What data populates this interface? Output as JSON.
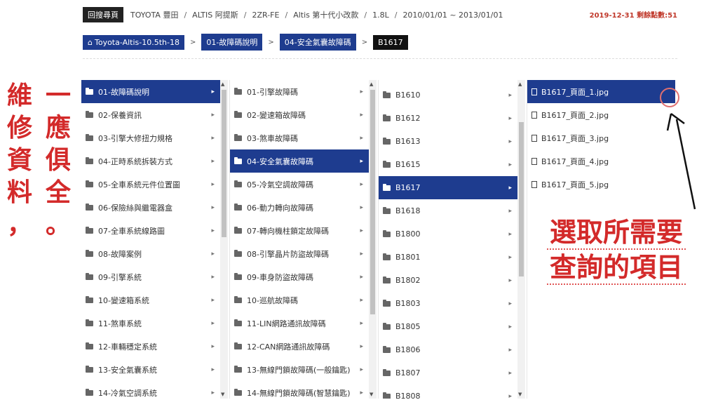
{
  "topbar": {
    "back_label": "回搜尋頁",
    "crumbs": [
      "TOYOTA 豐田",
      "ALTIS 阿提斯",
      "2ZR-FE",
      "Altis 第十代小改款",
      "1.8L",
      "2010/01/01 ~ 2013/01/01"
    ],
    "separator": "/",
    "status": "2019-12-31 剩餘點數:51"
  },
  "path": {
    "items": [
      "Toyota-Altis-10.5th-18",
      "01-故障碼說明",
      "04-安全氣囊故障碼",
      "B1617"
    ],
    "separator": ">"
  },
  "side_note": {
    "col1": [
      "一",
      "應",
      "俱",
      "全",
      "。"
    ],
    "col2": [
      "維",
      "修",
      "資",
      "料",
      "，"
    ]
  },
  "callout": [
    "選取所需要",
    "查詢的項目"
  ],
  "columns": {
    "c1": [
      "01-故障碼說明",
      "02-保養資訊",
      "03-引擎大修扭力規格",
      "04-正時系統拆裝方式",
      "05-全車系統元件位置圖",
      "06-保險絲與繼電器盒",
      "07-全車系統線路圖",
      "08-故障案例",
      "09-引擎系統",
      "10-變速箱系統",
      "11-煞車系統",
      "12-車輛穩定系統",
      "13-安全氣囊系統",
      "14-冷氣空調系統"
    ],
    "c2": [
      "01-引擎故障碼",
      "02-變速箱故障碼",
      "03-煞車故障碼",
      "04-安全氣囊故障碼",
      "05-冷氣空調故障碼",
      "06-動力轉向故障碼",
      "07-轉向機柱鎖定故障碼",
      "08-引擎晶片防盜故障碼",
      "09-車身防盜故障碼",
      "10-巡航故障碼",
      "11-LIN網路通訊故障碼",
      "12-CAN網路通訊故障碼",
      "13-無線門鎖故障碼(一般鑰匙)",
      "14-無線門鎖故障碼(智慧鑰匙)"
    ],
    "c3": [
      "B1610",
      "B1612",
      "B1613",
      "B1615",
      "B1617",
      "B1618",
      "B1800",
      "B1801",
      "B1802",
      "B1803",
      "B1805",
      "B1806",
      "B1807",
      "B1808"
    ],
    "c4": [
      "B1617_頁面_1.jpg",
      "B1617_頁面_2.jpg",
      "B1617_頁面_3.jpg",
      "B1617_頁面_4.jpg",
      "B1617_頁面_5.jpg"
    ]
  },
  "selected": {
    "c1": 0,
    "c2": 3,
    "c3": 4,
    "c4": 0
  },
  "colors": {
    "accent": "#1e3c8f",
    "annotation": "#d32a2a"
  },
  "icons": {
    "home": "home-icon",
    "folder": "folder-icon",
    "file": "file-icon",
    "arrow": "chevron-right-icon"
  }
}
